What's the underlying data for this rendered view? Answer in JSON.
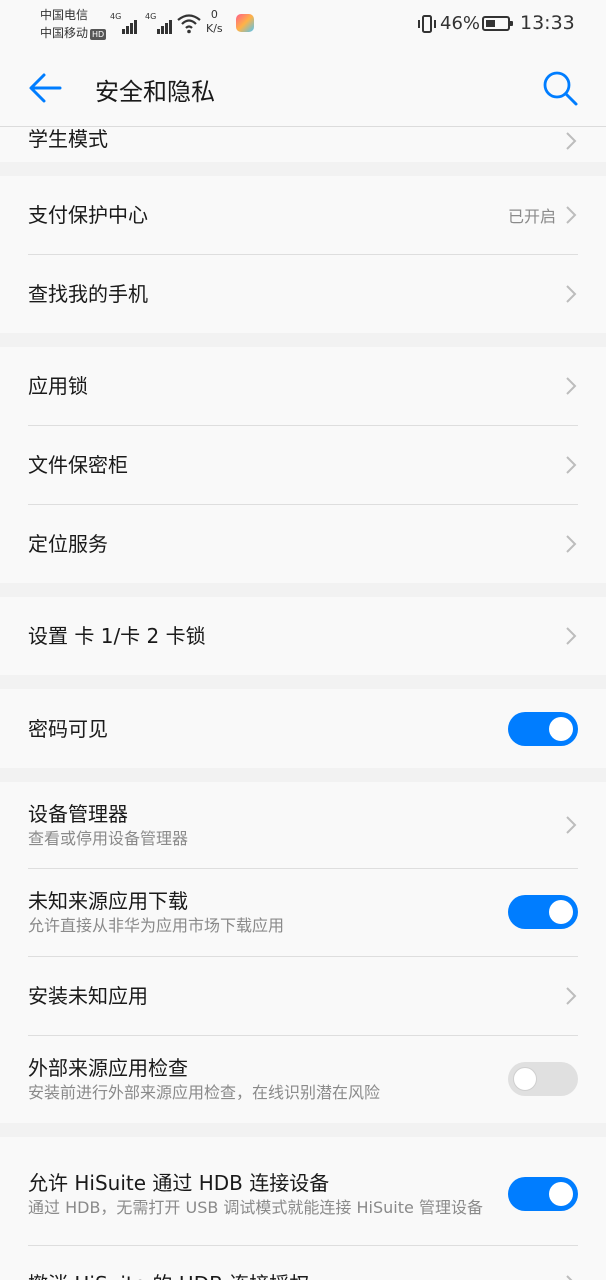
{
  "status_bar": {
    "carrier1": "中国电信",
    "carrier2": "中国移动",
    "hd": "HD",
    "signal1_label": "4G",
    "signal2_label": "4G",
    "speed_value": "0",
    "speed_unit": "K/s",
    "battery_percent": "46%",
    "battery_level": 0.46,
    "time": "13:33"
  },
  "header": {
    "title": "安全和隐私"
  },
  "colors": {
    "accent": "#007dff",
    "toggle_off": "#e0e0e0"
  },
  "rows": {
    "student_mode": {
      "title": "学生模式"
    },
    "payment": {
      "title": "支付保护中心",
      "value": "已开启"
    },
    "find_phone": {
      "title": "查找我的手机"
    },
    "app_lock": {
      "title": "应用锁"
    },
    "file_safe": {
      "title": "文件保密柜"
    },
    "location": {
      "title": "定位服务"
    },
    "sim_lock": {
      "title": "设置 卡 1/卡 2 卡锁"
    },
    "show_password": {
      "title": "密码可见",
      "enabled": true
    },
    "device_admin": {
      "title": "设备管理器",
      "subtitle": "查看或停用设备管理器"
    },
    "unknown_download": {
      "title": "未知来源应用下载",
      "subtitle": "允许直接从非华为应用市场下载应用",
      "enabled": true
    },
    "install_unknown": {
      "title": "安装未知应用"
    },
    "external_check": {
      "title": "外部来源应用检查",
      "subtitle": "安装前进行外部来源应用检查，在线识别潜在风险",
      "enabled": false
    },
    "hisuite_hdb": {
      "title": "允许 HiSuite 通过 HDB 连接设备",
      "subtitle": "通过 HDB，无需打开 USB 调试模式就能连接 HiSuite 管理设备",
      "enabled": true
    },
    "revoke_hdb": {
      "title": "撤消 HiSuite 的 HDB 连接授权"
    }
  }
}
